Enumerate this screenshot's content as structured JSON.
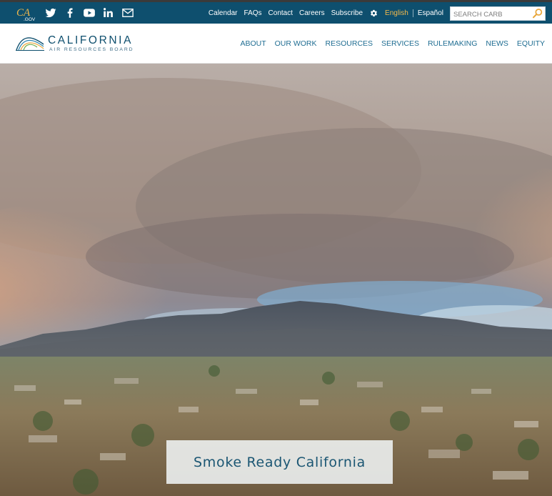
{
  "utility": {
    "cagov_logo_text": "CA.GOV",
    "social": [
      {
        "icon": "twitter-icon"
      },
      {
        "icon": "facebook-icon"
      },
      {
        "icon": "youtube-icon"
      },
      {
        "icon": "linkedin-icon"
      },
      {
        "icon": "email-icon"
      }
    ],
    "links": [
      "Calendar",
      "FAQs",
      "Contact",
      "Careers",
      "Subscribe"
    ],
    "settings_icon": "gear-icon",
    "language_active": "English",
    "language_other": "Español",
    "search_placeholder": "SEARCH CARB",
    "colors": {
      "bar": "#0e4f6e",
      "active_language": "#f2b84b"
    }
  },
  "header": {
    "logo_title": "CALIFORNIA",
    "logo_subtitle": "AIR RESOURCES BOARD",
    "nav": [
      "ABOUT",
      "OUR WORK",
      "RESOURCES",
      "SERVICES",
      "RULEMAKING",
      "NEWS",
      "EQUITY"
    ],
    "colors": {
      "nav_text": "#1f6d92",
      "brand": "#0e4f6e"
    }
  },
  "hero": {
    "caption": "Smoke Ready California"
  }
}
